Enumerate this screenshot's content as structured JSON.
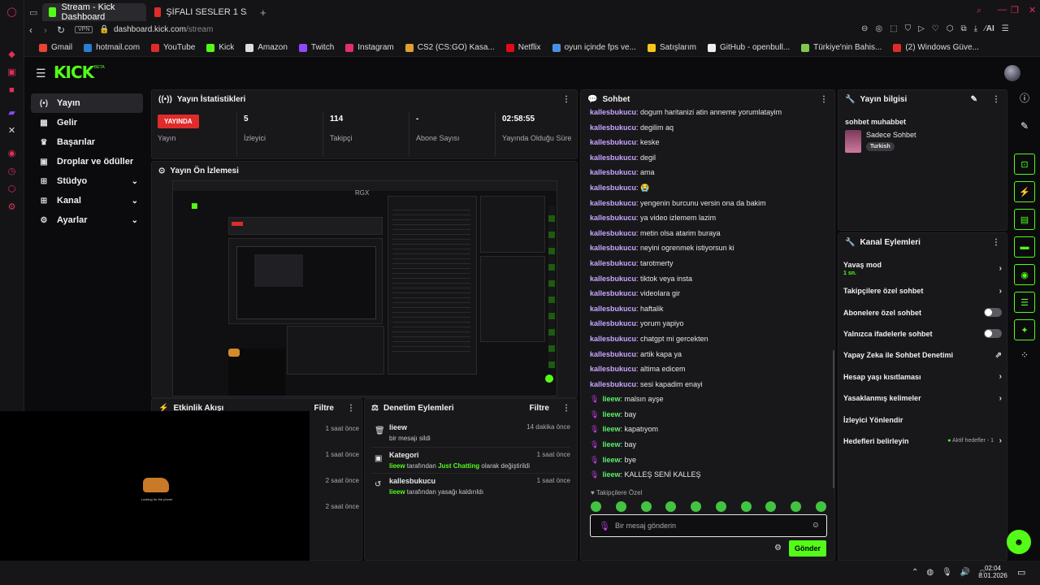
{
  "browser": {
    "tabs": [
      {
        "label": "Stream - Kick Dashboard",
        "color": "#53fc18"
      },
      {
        "label": "ŞİFALI SESLER 1 SAAT LÜT",
        "color": "#e02b2b"
      }
    ],
    "new_tab": "+",
    "vpn": "VPN",
    "url_domain": "dashboard.kick.com",
    "url_path": "/stream",
    "ai_label": "AI",
    "bookmarks": [
      {
        "label": "Gmail",
        "color": "#ea4335"
      },
      {
        "label": "hotmail.com",
        "color": "#2b7cd3"
      },
      {
        "label": "YouTube",
        "color": "#e02b2b"
      },
      {
        "label": "Kick",
        "color": "#53fc18"
      },
      {
        "label": "Amazon",
        "color": "#dddddd"
      },
      {
        "label": "Twitch",
        "color": "#9146ff"
      },
      {
        "label": "Instagram",
        "color": "#e1306c"
      },
      {
        "label": "CS2 (CS:GO) Kasa...",
        "color": "#e0a030"
      },
      {
        "label": "Netflix",
        "color": "#e50914"
      },
      {
        "label": "oyun içinde fps ve...",
        "color": "#4a90e2"
      },
      {
        "label": "Satışlarım",
        "color": "#f5c518"
      },
      {
        "label": "GitHub - openbull...",
        "color": "#eeeeee"
      },
      {
        "label": "Türkiye'nin Bahis...",
        "color": "#7ec850"
      },
      {
        "label": "(2) Windows Güve...",
        "color": "#e02b2b"
      }
    ]
  },
  "app": {
    "logo": "KICK",
    "logo_beta": "BETA",
    "accent": "#53fc18"
  },
  "sidebar": {
    "items": [
      {
        "label": "Yayın",
        "icon": "(•)"
      },
      {
        "label": "Gelir",
        "icon": "▦"
      },
      {
        "label": "Başarılar",
        "icon": "♛"
      },
      {
        "label": "Droplar ve ödüller",
        "icon": "▣"
      },
      {
        "label": "Stüdyo",
        "icon": "⊞"
      },
      {
        "label": "Kanal",
        "icon": "⊞"
      },
      {
        "label": "Ayarlar",
        "icon": "⚙"
      }
    ]
  },
  "stats": {
    "title": "Yayın İstatistikleri",
    "live_badge": "YAYINDA",
    "live_label": "Yayın",
    "items": [
      {
        "value": "5",
        "label": "İzleyici"
      },
      {
        "value": "114",
        "label": "Takipçi"
      },
      {
        "value": "-",
        "label": "Abone Sayısı"
      },
      {
        "value": "02:58:55",
        "label": "Yayında Olduğu Süre"
      }
    ]
  },
  "preview": {
    "title": "Yayın Ön İzlemesi",
    "overlay_label": "RGX"
  },
  "activity": {
    "title": "Etkinlik Akışı",
    "filter": "Filtre",
    "times": [
      "1 saat önce",
      "1 saat önce",
      "2 saat önce",
      "2 saat önce"
    ]
  },
  "webcam": {
    "caption": "Looking for the phone"
  },
  "moderation": {
    "title": "Denetim Eylemleri",
    "filter": "Filtre",
    "rows": [
      {
        "user": "lieew",
        "time": "14 dakika önce",
        "desc": "bir mesajı sildi",
        "actor": "",
        "highlight": "",
        "suffix": ""
      },
      {
        "user": "Kategori",
        "time": "1 saat önce",
        "desc": "",
        "actor": "lieew",
        "mid": " tarafından ",
        "highlight": "Just Chatting",
        "suffix": " olarak değiştirildi"
      },
      {
        "user": "kallesbukucu",
        "time": "1 saat önce",
        "desc": "",
        "actor": "lieew",
        "mid": " tarafından yasağı kaldırıldı",
        "highlight": "",
        "suffix": ""
      }
    ]
  },
  "chat": {
    "title": "Sohbet",
    "messages": [
      {
        "user": "kallesbukucu",
        "text": ": dogum haritanizi atin anneme yorumlatayim"
      },
      {
        "user": "kallesbukucu",
        "text": ": degilim aq"
      },
      {
        "user": "kallesbukucu",
        "text": ": keske"
      },
      {
        "user": "kallesbukucu",
        "text": ": degil"
      },
      {
        "user": "kallesbukucu",
        "text": ": ama"
      },
      {
        "user": "kallesbukucu",
        "text": ": 😭"
      },
      {
        "user": "kallesbukucu",
        "text": ": yengenin burcunu versin ona da bakim"
      },
      {
        "user": "kallesbukucu",
        "text": ": ya video izlemem lazim"
      },
      {
        "user": "kallesbukucu",
        "text": ": metin olsa atarim buraya"
      },
      {
        "user": "kallesbukucu",
        "text": ": neyini ogrenmek istiyorsun ki"
      },
      {
        "user": "kallesbukucu",
        "text": ": tarotmerty"
      },
      {
        "user": "kallesbukucu",
        "text": ": tiktok veya insta"
      },
      {
        "user": "kallesbukucu",
        "text": ": videolara gir"
      },
      {
        "user": "kallesbukucu",
        "text": ": haftalik"
      },
      {
        "user": "kallesbukucu",
        "text": ": yorum yapiyo"
      },
      {
        "user": "kallesbukucu",
        "text": ": chatgpt mi gercekten"
      },
      {
        "user": "kallesbukucu",
        "text": ": artik kapa ya"
      },
      {
        "user": "kallesbukucu",
        "text": ": altima edicem"
      },
      {
        "user": "kallesbukucu",
        "text": ": sesi kapadim enayi"
      },
      {
        "user": "lieew",
        "text": ": malsın ayşe",
        "host": true
      },
      {
        "user": "lieew",
        "text": ": bay",
        "host": true
      },
      {
        "user": "lieew",
        "text": ": kapatıyom",
        "host": true
      },
      {
        "user": "lieew",
        "text": ": bay",
        "host": true
      },
      {
        "user": "lieew",
        "text": ": bye",
        "host": true
      },
      {
        "user": "lieew",
        "text": ": KALLEŞ SENİ KALLEŞ",
        "host": true
      }
    ],
    "followers_only": "Takipçilere Özel",
    "input_placeholder": "Bir mesaj gönderin",
    "send": "Gönder"
  },
  "stream_info": {
    "title": "Yayın bilgisi",
    "stream_title": "sohbet muhabbet",
    "category": "Sadece Sohbet",
    "language": "Turkish"
  },
  "channel_actions": {
    "title": "Kanal Eylemleri",
    "slow_mode": "Yavaş mod",
    "slow_mode_value": "1 sn.",
    "rows": [
      {
        "label": "Takipçilere özel sohbet",
        "kind": "chevron"
      },
      {
        "label": "Abonelere özel sohbet",
        "kind": "toggle"
      },
      {
        "label": "Yalnızca ifadelerle sohbet",
        "kind": "toggle"
      },
      {
        "label": "Yapay Zeka ile Sohbet Denetimi",
        "kind": "external"
      },
      {
        "label": "Hesap yaşı kısıtlaması",
        "kind": "chevron"
      },
      {
        "label": "Yasaklanmış kelimeler",
        "kind": "chevron"
      },
      {
        "label": "İzleyici Yönlendir",
        "kind": "none"
      },
      {
        "label": "Hedefleri belirleyin",
        "kind": "goal"
      }
    ],
    "goal_status": "Aktif hedefler - 1"
  },
  "taskbar": {
    "time": "02:04",
    "date": "8.01.2026"
  }
}
